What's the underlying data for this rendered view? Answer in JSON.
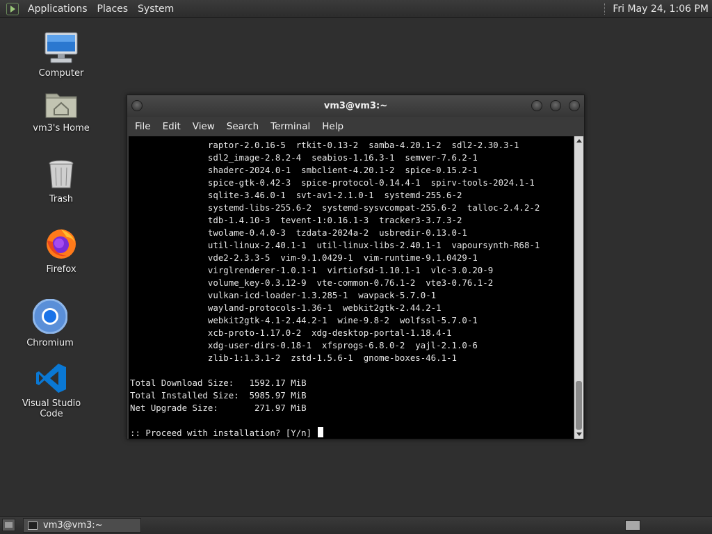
{
  "top_panel": {
    "menus": [
      "Applications",
      "Places",
      "System"
    ],
    "clock": "Fri May 24,  1:06 PM"
  },
  "desktop": {
    "icons": [
      {
        "label": "Computer",
        "icon": "computer-icon"
      },
      {
        "label": "vm3's Home",
        "icon": "home-folder-icon"
      },
      {
        "label": "Trash",
        "icon": "trash-icon"
      },
      {
        "label": "Firefox",
        "icon": "firefox-icon"
      },
      {
        "label": "Chromium",
        "icon": "chromium-icon"
      },
      {
        "label": "Visual Studio Code",
        "icon": "vscode-icon"
      }
    ]
  },
  "terminal": {
    "title": "vm3@vm3:~",
    "menu": [
      "File",
      "Edit",
      "View",
      "Search",
      "Terminal",
      "Help"
    ],
    "lines": [
      "               raptor-2.0.16-5  rtkit-0.13-2  samba-4.20.1-2  sdl2-2.30.3-1",
      "               sdl2_image-2.8.2-4  seabios-1.16.3-1  semver-7.6.2-1",
      "               shaderc-2024.0-1  smbclient-4.20.1-2  spice-0.15.2-1",
      "               spice-gtk-0.42-3  spice-protocol-0.14.4-1  spirv-tools-2024.1-1",
      "               sqlite-3.46.0-1  svt-av1-2.1.0-1  systemd-255.6-2",
      "               systemd-libs-255.6-2  systemd-sysvcompat-255.6-2  talloc-2.4.2-2",
      "               tdb-1.4.10-3  tevent-1:0.16.1-3  tracker3-3.7.3-2",
      "               twolame-0.4.0-3  tzdata-2024a-2  usbredir-0.13.0-1",
      "               util-linux-2.40.1-1  util-linux-libs-2.40.1-1  vapoursynth-R68-1",
      "               vde2-2.3.3-5  vim-9.1.0429-1  vim-runtime-9.1.0429-1",
      "               virglrenderer-1.0.1-1  virtiofsd-1.10.1-1  vlc-3.0.20-9",
      "               volume_key-0.3.12-9  vte-common-0.76.1-2  vte3-0.76.1-2",
      "               vulkan-icd-loader-1.3.285-1  wavpack-5.7.0-1",
      "               wayland-protocols-1.36-1  webkit2gtk-2.44.2-1",
      "               webkit2gtk-4.1-2.44.2-1  wine-9.8-2  wolfssl-5.7.0-1",
      "               xcb-proto-1.17.0-2  xdg-desktop-portal-1.18.4-1",
      "               xdg-user-dirs-0.18-1  xfsprogs-6.8.0-2  yajl-2.1.0-6",
      "               zlib-1:1.3.1-2  zstd-1.5.6-1  gnome-boxes-46.1-1",
      "",
      "Total Download Size:   1592.17 MiB",
      "Total Installed Size:  5985.97 MiB",
      "Net Upgrade Size:       271.97 MiB",
      "",
      ":: Proceed with installation? [Y/n] "
    ]
  },
  "taskbar": {
    "window_button": "vm3@vm3:~"
  }
}
